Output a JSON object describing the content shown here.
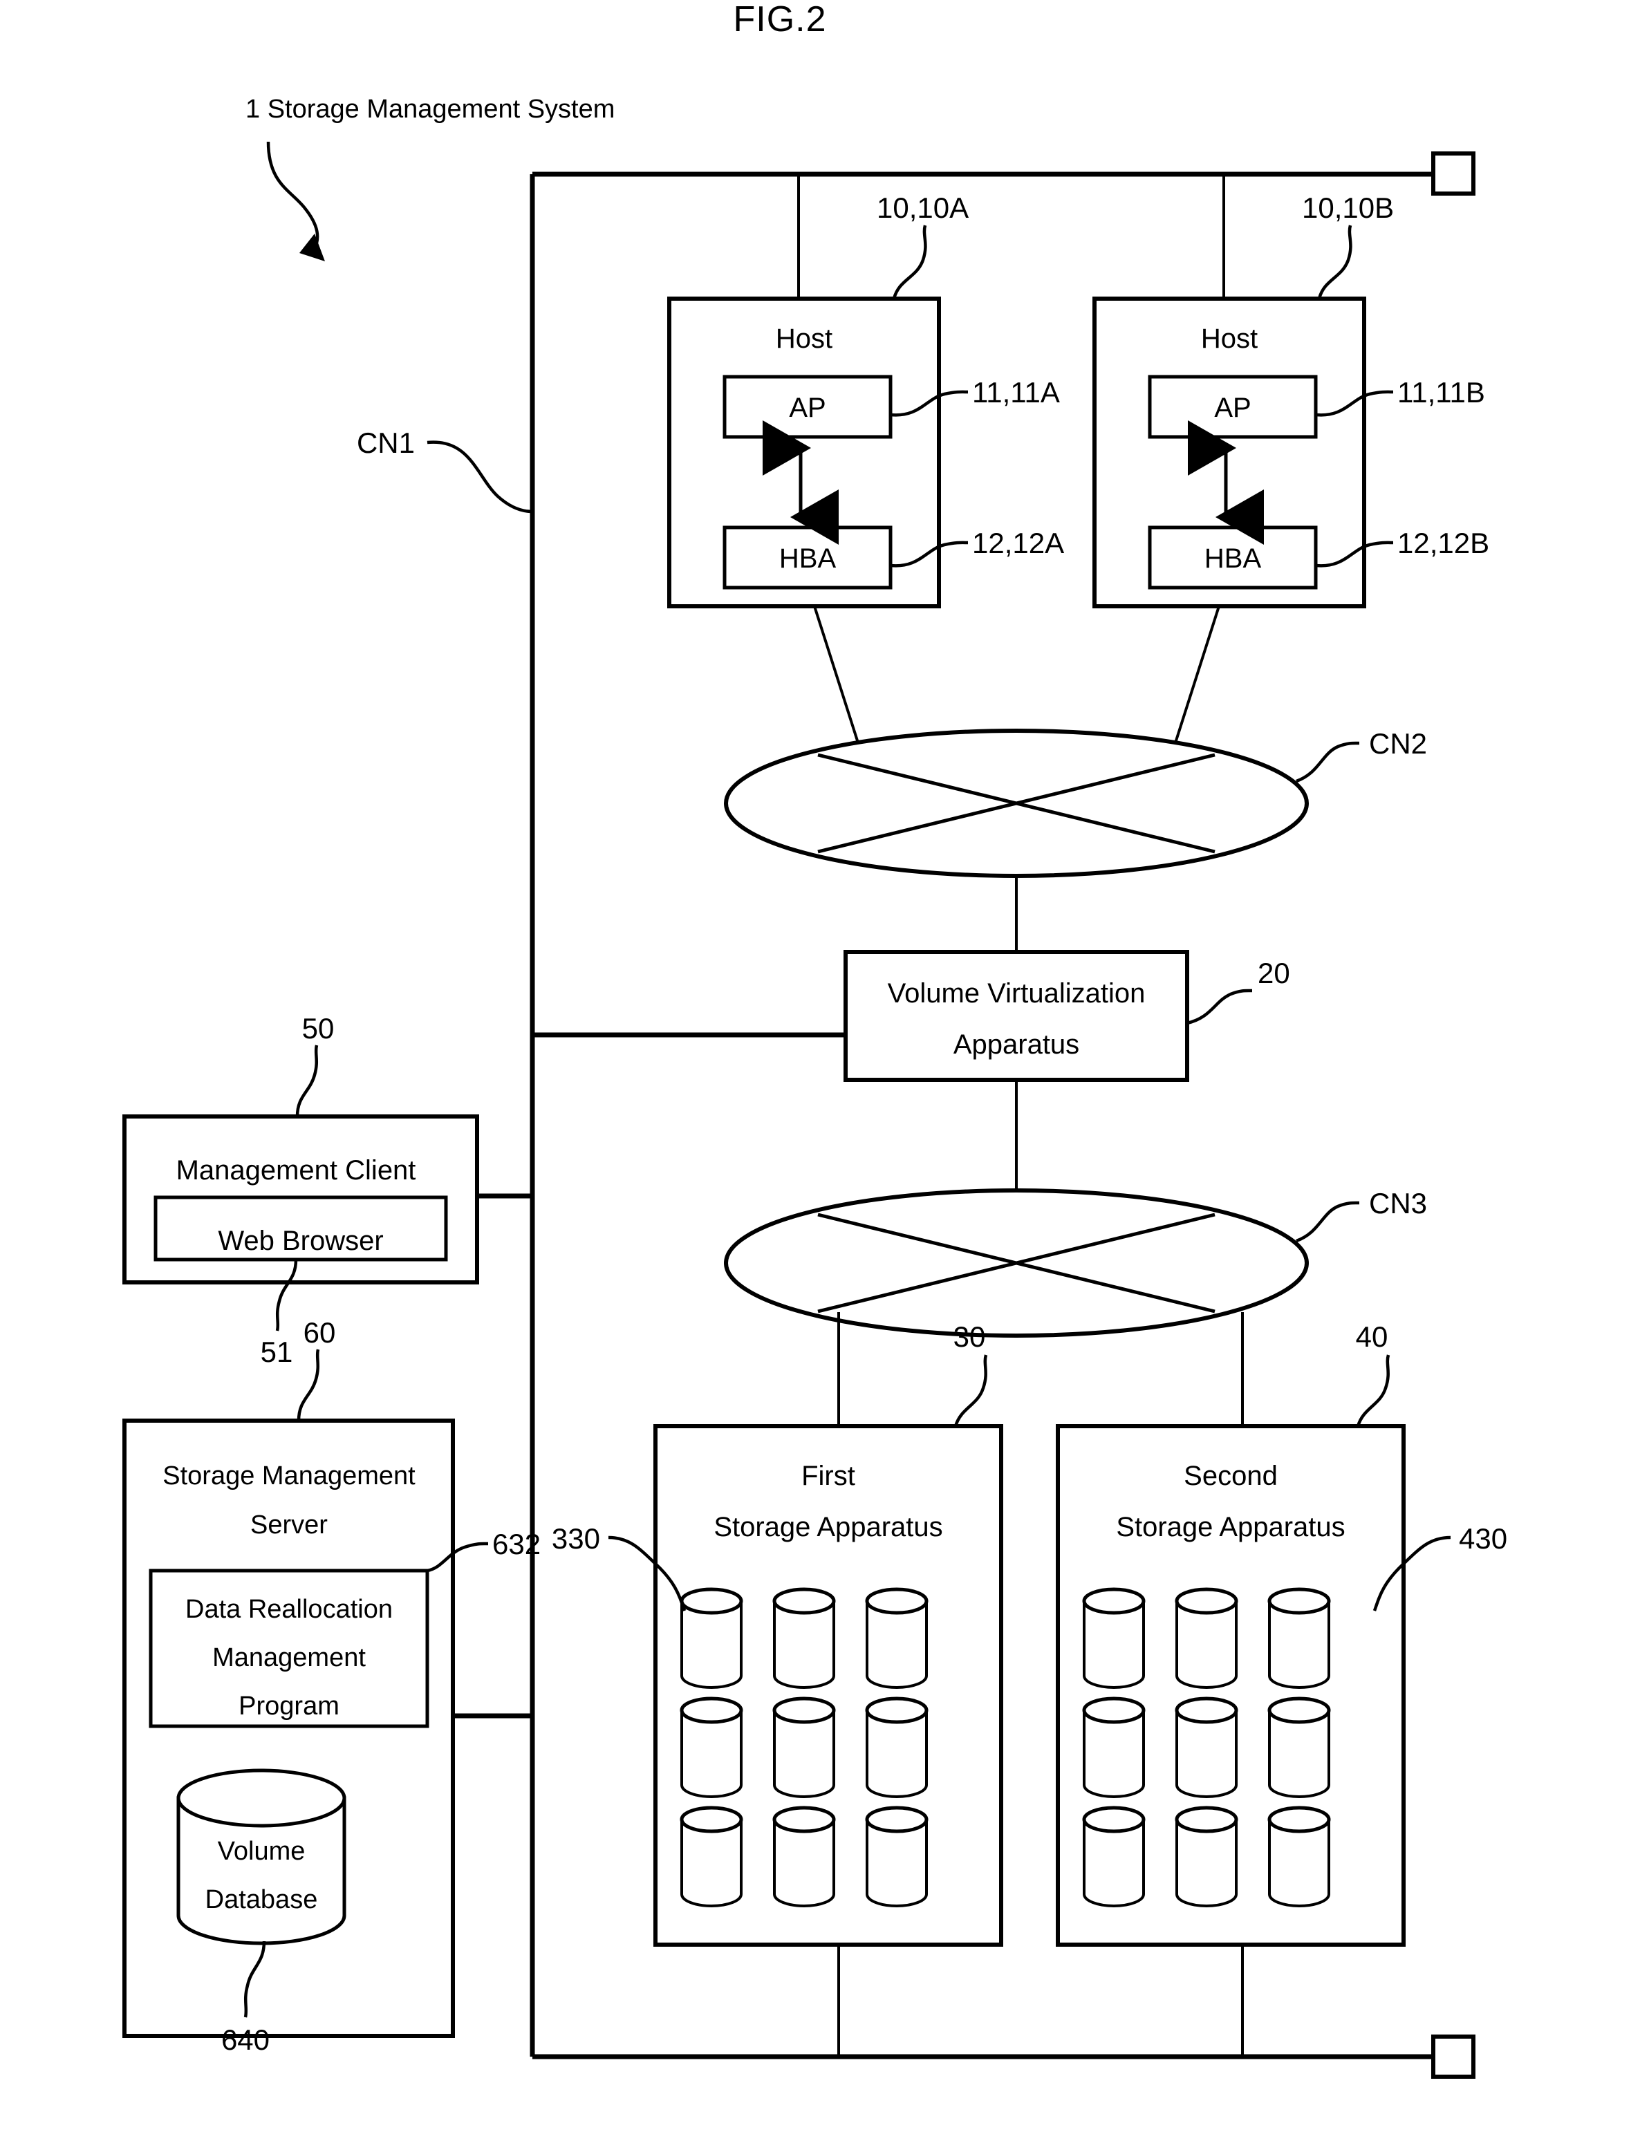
{
  "figure": {
    "title": "FIG.2",
    "caption": "1 Storage Management System"
  },
  "networks": [
    {
      "id": "cn1",
      "label": "CN1",
      "type": "bus"
    },
    {
      "id": "cn2",
      "label": "CN2",
      "type": "ellipse-switch"
    },
    {
      "id": "cn3",
      "label": "CN3",
      "type": "ellipse-switch"
    }
  ],
  "hosts": [
    {
      "id": "host_a",
      "title": "Host",
      "ref": "10,10A",
      "components": [
        {
          "label": "AP",
          "ref": "11,11A"
        },
        {
          "label": "HBA",
          "ref": "12,12A"
        }
      ]
    },
    {
      "id": "host_b",
      "title": "Host",
      "ref": "10,10B",
      "components": [
        {
          "label": "AP",
          "ref": "11,11B"
        },
        {
          "label": "HBA",
          "ref": "12,12B"
        }
      ]
    }
  ],
  "virtualization": {
    "title_line1": "Volume Virtualization",
    "title_line2": "Apparatus",
    "ref": "20"
  },
  "management_client": {
    "title": "Management Client",
    "ref": "50",
    "child": {
      "label": "Web Browser",
      "ref": "51"
    }
  },
  "management_server": {
    "title_line1": "Storage Management",
    "title_line2": "Server",
    "ref": "60",
    "program": {
      "line1": "Data Reallocation",
      "line2": "Management",
      "line3": "Program",
      "ref": "632"
    },
    "database": {
      "line1": "Volume",
      "line2": "Database",
      "ref": "640"
    }
  },
  "storage_apparatuses": [
    {
      "id": "first_storage",
      "title_line1": "First",
      "title_line2": "Storage Apparatus",
      "ref": "30",
      "disk_ref": "330",
      "disk_count": 9,
      "disk_rows": 3,
      "disk_cols": 3
    },
    {
      "id": "second_storage",
      "title_line1": "Second",
      "title_line2": "Storage Apparatus",
      "ref": "40",
      "disk_ref": "430",
      "disk_count": 9,
      "disk_rows": 3,
      "disk_cols": 3
    }
  ],
  "terminals": [
    {
      "id": "terminal_top",
      "shape": "square"
    },
    {
      "id": "terminal_bottom",
      "shape": "square"
    }
  ],
  "colors": {
    "ink": "#000000",
    "paper": "#ffffff"
  }
}
